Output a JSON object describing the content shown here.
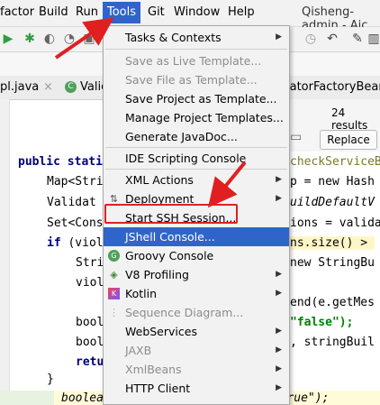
{
  "menubar": {
    "items": [
      "Refactor",
      "Build",
      "Run",
      "Tools",
      "Git",
      "Window",
      "Help"
    ],
    "visible": [
      "factor",
      "Build",
      "Run",
      "Tools",
      "Git",
      "Window",
      "Help"
    ],
    "title": "Qisheng-admin - Aic"
  },
  "tabs": [
    {
      "label": "pl.java"
    },
    {
      "label": "Valic"
    },
    {
      "label": "latorFactoryBean."
    }
  ],
  "find": {
    "results": "24 results",
    "replace_label": "Replace"
  },
  "code": [
    "public stati",
    "Map<Stri",
    "Validat",
    "Set<Cons",
    "if (viol",
    "Stri",
    "viol",
    "bool",
    "bool",
    "retu",
    "}",
    "checkServiceB",
    "p = new Hash",
    "uildDefaultV",
    "ions = valida",
    "ns.size() > ",
    "new StringBu",
    "end(e.getMes",
    "\"false\");",
    ", stringBuil",
    "booleanStringMap.put(\"valid\", \"true\");"
  ],
  "menu": {
    "items": [
      {
        "label": "Tasks & Contexts",
        "submenu": true,
        "disabled": false
      },
      {
        "label": "Save as Live Template...",
        "disabled": true
      },
      {
        "label": "Save File as Template...",
        "disabled": true
      },
      {
        "label": "Save Project as Template...",
        "disabled": false
      },
      {
        "label": "Manage Project Templates...",
        "disabled": false
      },
      {
        "label": "Generate JavaDoc...",
        "disabled": false
      },
      {
        "label": "IDE Scripting Console",
        "disabled": false
      },
      {
        "label": "XML Actions",
        "submenu": true,
        "disabled": false
      },
      {
        "label": "Deployment",
        "submenu": true,
        "disabled": false
      },
      {
        "label": "Start SSH Session...",
        "disabled": false
      },
      {
        "label": "JShell Console...",
        "disabled": false,
        "selected": true
      },
      {
        "label": "Groovy Console",
        "disabled": false
      },
      {
        "label": "V8 Profiling",
        "submenu": true,
        "disabled": false
      },
      {
        "label": "Kotlin",
        "submenu": true,
        "disabled": false
      },
      {
        "label": "Sequence Diagram...",
        "disabled": true
      },
      {
        "label": "WebServices",
        "submenu": true,
        "disabled": false
      },
      {
        "label": "JAXB",
        "submenu": true,
        "disabled": true
      },
      {
        "label": "XmlBeans",
        "submenu": true,
        "disabled": true
      },
      {
        "label": "HTTP Client",
        "submenu": true,
        "disabled": false
      }
    ]
  },
  "colors": {
    "accent": "#2f65ca",
    "annotation": "#e02020"
  }
}
